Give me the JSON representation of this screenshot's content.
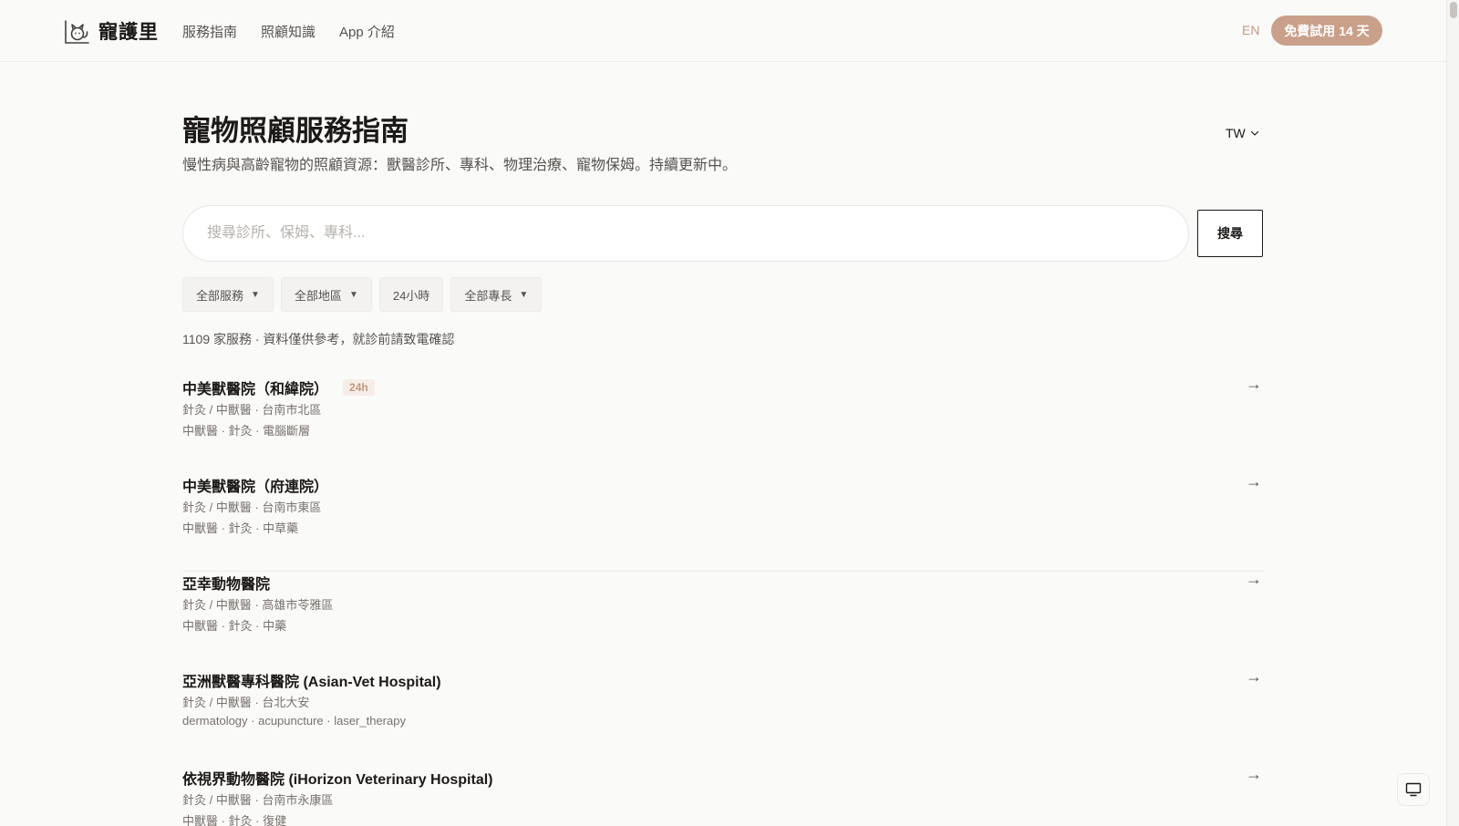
{
  "header": {
    "brand_name": "寵護里",
    "nav": [
      "服務指南",
      "照顧知識",
      "App 介紹"
    ],
    "lang_label": "EN",
    "trial_button": "免費試用 14 天"
  },
  "page": {
    "title": "寵物照顧服務指南",
    "subtitle": "慢性病與高齡寵物的照顧資源：獸醫診所、專科、物理治療、寵物保姆。持續更新中。",
    "region": "TW"
  },
  "search": {
    "placeholder": "搜尋診所、保姆、專科...",
    "button_label": "搜尋"
  },
  "filters": [
    {
      "label": "全部服務",
      "dropdown": true
    },
    {
      "label": "全部地區",
      "dropdown": true
    },
    {
      "label": "24小時",
      "dropdown": false
    },
    {
      "label": "全部專長",
      "dropdown": true
    }
  ],
  "results": {
    "count_text": "1109 家服務 · 資料僅供參考，就診前請致電確認",
    "items": [
      {
        "name": "中美獸醫院（和緯院）",
        "badge": "24h",
        "meta": "針灸 / 中獸醫 · 台南市北區",
        "tags": "中獸醫 · 針灸 · 電腦斷層"
      },
      {
        "name": "中美獸醫院（府連院）",
        "badge": "",
        "meta": "針灸 / 中獸醫 · 台南市東區",
        "tags": "中獸醫 · 針灸 · 中草藥"
      },
      {
        "name": "亞幸動物醫院",
        "badge": "",
        "meta": "針灸 / 中獸醫 · 高雄市苓雅區",
        "tags": "中獸醫 · 針灸 · 中藥"
      },
      {
        "name": "亞洲獸醫專科醫院 (Asian-Vet Hospital)",
        "badge": "",
        "meta": "針灸 / 中獸醫 · 台北大安",
        "tags": "dermatology · acupuncture · laser_therapy"
      },
      {
        "name": "依視界動物醫院 (iHorizon Veterinary Hospital)",
        "badge": "",
        "meta": "針灸 / 中獸醫 · 台南市永康區",
        "tags": "中獸醫 · 針灸 · 復健"
      }
    ]
  },
  "icons": {
    "logo": "pet-logo-icon",
    "arrow": "arrow-right-icon",
    "chevron": "chevron-down-icon",
    "caret": "caret-down-icon",
    "monitor": "monitor-icon"
  },
  "colors": {
    "accent": "#c9a08a",
    "accent_text": "#c49a82",
    "background": "#fafaf9",
    "text": "#1c1917",
    "muted": "#78716c"
  }
}
